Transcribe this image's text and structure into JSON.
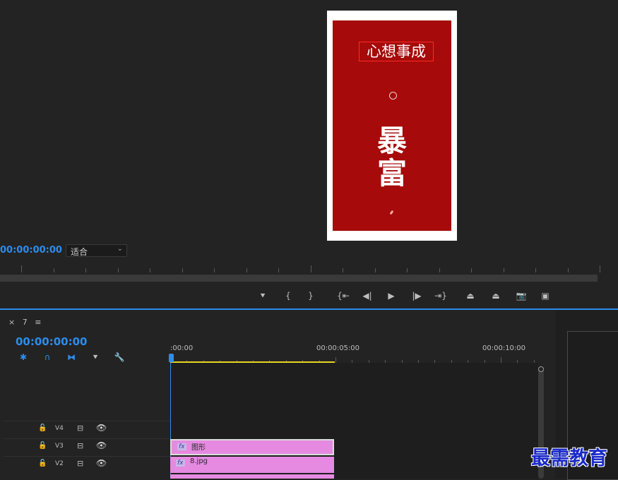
{
  "program_monitor": {
    "preview": {
      "greeting": "心想事成",
      "big_chars": [
        "暴",
        "富"
      ],
      "card_color": "#a60a0a"
    },
    "timecode": "00:00:00:00",
    "fit_select": {
      "value": "适合"
    }
  },
  "transport": {
    "buttons": [
      {
        "name": "add-marker-button",
        "icon": "marker-icon",
        "glyph": "⯆"
      },
      {
        "name": "mark-in-button",
        "icon": "mark-in-icon",
        "glyph": "{"
      },
      {
        "name": "mark-out-button",
        "icon": "mark-out-icon",
        "glyph": "}"
      },
      {
        "name": "go-to-in-button",
        "icon": "go-to-in-icon",
        "glyph": "{⇤"
      },
      {
        "name": "step-back-button",
        "icon": "step-back-icon",
        "glyph": "◀|"
      },
      {
        "name": "play-button",
        "icon": "play-icon",
        "glyph": "▶"
      },
      {
        "name": "step-forward-button",
        "icon": "step-forward-icon",
        "glyph": "|▶"
      },
      {
        "name": "go-to-out-button",
        "icon": "go-to-out-icon",
        "glyph": "⇥}"
      },
      {
        "name": "lift-button",
        "icon": "lift-icon",
        "glyph": "⏏"
      },
      {
        "name": "extract-button",
        "icon": "extract-icon",
        "glyph": "⏏"
      },
      {
        "name": "export-frame-button",
        "icon": "camera-icon",
        "glyph": "📷"
      },
      {
        "name": "compare-button",
        "icon": "compare-icon",
        "glyph": "▣"
      }
    ]
  },
  "timeline": {
    "tab_close": "×",
    "tab_label": "7",
    "tab_menu": "≡",
    "timecode": "00:00:00:00",
    "tools": [
      {
        "name": "nest-tool",
        "icon": "nest-icon",
        "glyph": "✱",
        "color": "#2d8ceb"
      },
      {
        "name": "snap-tool",
        "icon": "magnet-icon",
        "glyph": "∩",
        "color": "#2d8ceb"
      },
      {
        "name": "linked-selection-tool",
        "icon": "linked-selection-icon",
        "glyph": "⧓",
        "color": "#2d8ceb"
      },
      {
        "name": "add-marker-tool",
        "icon": "marker-icon",
        "glyph": "⯆",
        "color": "#bdbdbd"
      },
      {
        "name": "timeline-settings-tool",
        "icon": "wrench-icon",
        "glyph": "🔧",
        "color": "#bdbdbd"
      }
    ],
    "ruler_labels": [
      ":00:00",
      "00:00:05:00",
      "00:00:10:00"
    ],
    "tracks": [
      {
        "label": "V4"
      },
      {
        "label": "V3"
      },
      {
        "label": "V2"
      }
    ],
    "clips": [
      {
        "fx": "fx",
        "name": "图形"
      },
      {
        "fx": "fx",
        "name": "8.jpg"
      }
    ]
  },
  "watermark": "最需教育"
}
